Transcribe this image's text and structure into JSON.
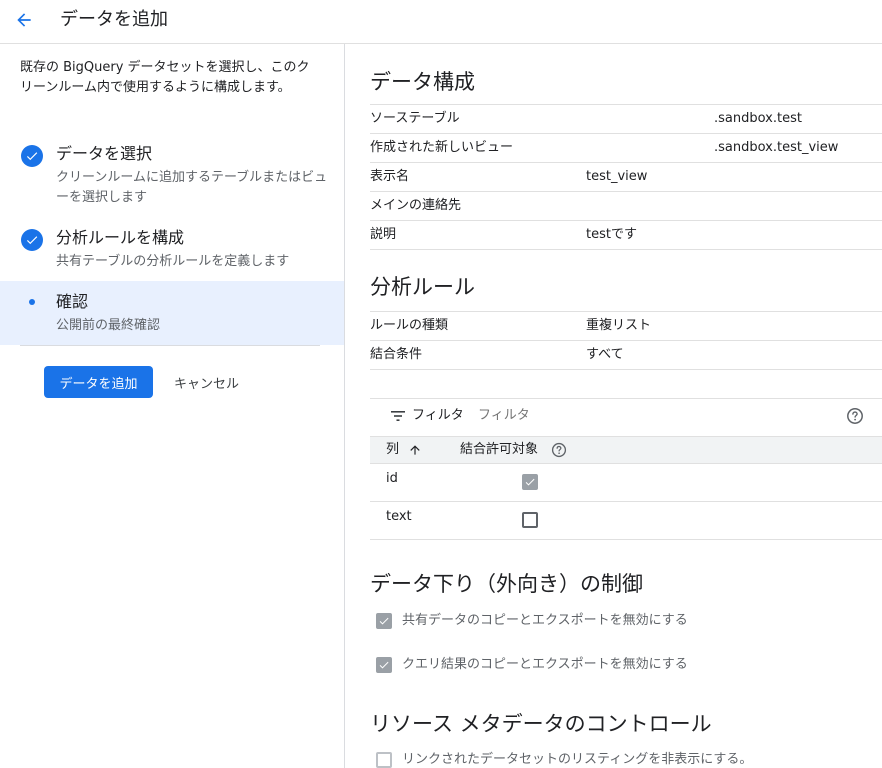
{
  "header": {
    "title": "データを追加"
  },
  "sidebar": {
    "intro": "既存の BigQuery データセットを選択し、このクリーンルーム内で使用するように構成します。",
    "steps": [
      {
        "title": "データを選択",
        "desc": "クリーンルームに追加するテーブルまたはビューを選択します",
        "state": "done"
      },
      {
        "title": "分析ルールを構成",
        "desc": "共有テーブルの分析ルールを定義します",
        "state": "done"
      },
      {
        "title": "確認",
        "desc": "公開前の最終確認",
        "state": "active"
      }
    ],
    "add_button": "データを追加",
    "cancel_button": "キャンセル"
  },
  "data_config": {
    "title": "データ構成",
    "rows": [
      {
        "label": "ソーステーブル",
        "value": ".sandbox.test"
      },
      {
        "label": "作成された新しいビュー",
        "value": ".sandbox.test_view"
      },
      {
        "label": "表示名",
        "value": "test_view"
      },
      {
        "label": "メインの連絡先",
        "value": ""
      },
      {
        "label": "説明",
        "value": "testです"
      }
    ]
  },
  "analysis_rules": {
    "title": "分析ルール",
    "rows": [
      {
        "label": "ルールの種類",
        "value": "重複リスト"
      },
      {
        "label": "結合条件",
        "value": "すべて"
      }
    ]
  },
  "filter": {
    "label": "フィルタ",
    "placeholder": "フィルタ"
  },
  "columns_table": {
    "headers": {
      "column": "列",
      "join_allowed": "結合許可対象"
    },
    "rows": [
      {
        "name": "id",
        "join_allowed": true
      },
      {
        "name": "text",
        "join_allowed": false
      }
    ]
  },
  "egress": {
    "title": "データ下り（外向き）の制御",
    "options": [
      {
        "label": "共有データのコピーとエクスポートを無効にする",
        "checked": true
      },
      {
        "label": "クエリ結果のコピーとエクスポートを無効にする",
        "checked": true
      }
    ]
  },
  "metadata": {
    "title": "リソース メタデータのコントロール",
    "options": [
      {
        "label": "リンクされたデータセットのリスティングを非表示にする。",
        "checked": false
      }
    ]
  },
  "colors": {
    "accent": "#1a73e8",
    "active_step_bg": "#e8f0fe",
    "text": "#202124",
    "secondary_text": "#5f6368"
  },
  "icons": {
    "back": "arrow-left-icon",
    "step_done": "check-circle-icon",
    "step_active": "dot-icon",
    "filter": "filter-list-icon",
    "help": "help-circle-icon",
    "sort": "arrow-up-icon"
  }
}
